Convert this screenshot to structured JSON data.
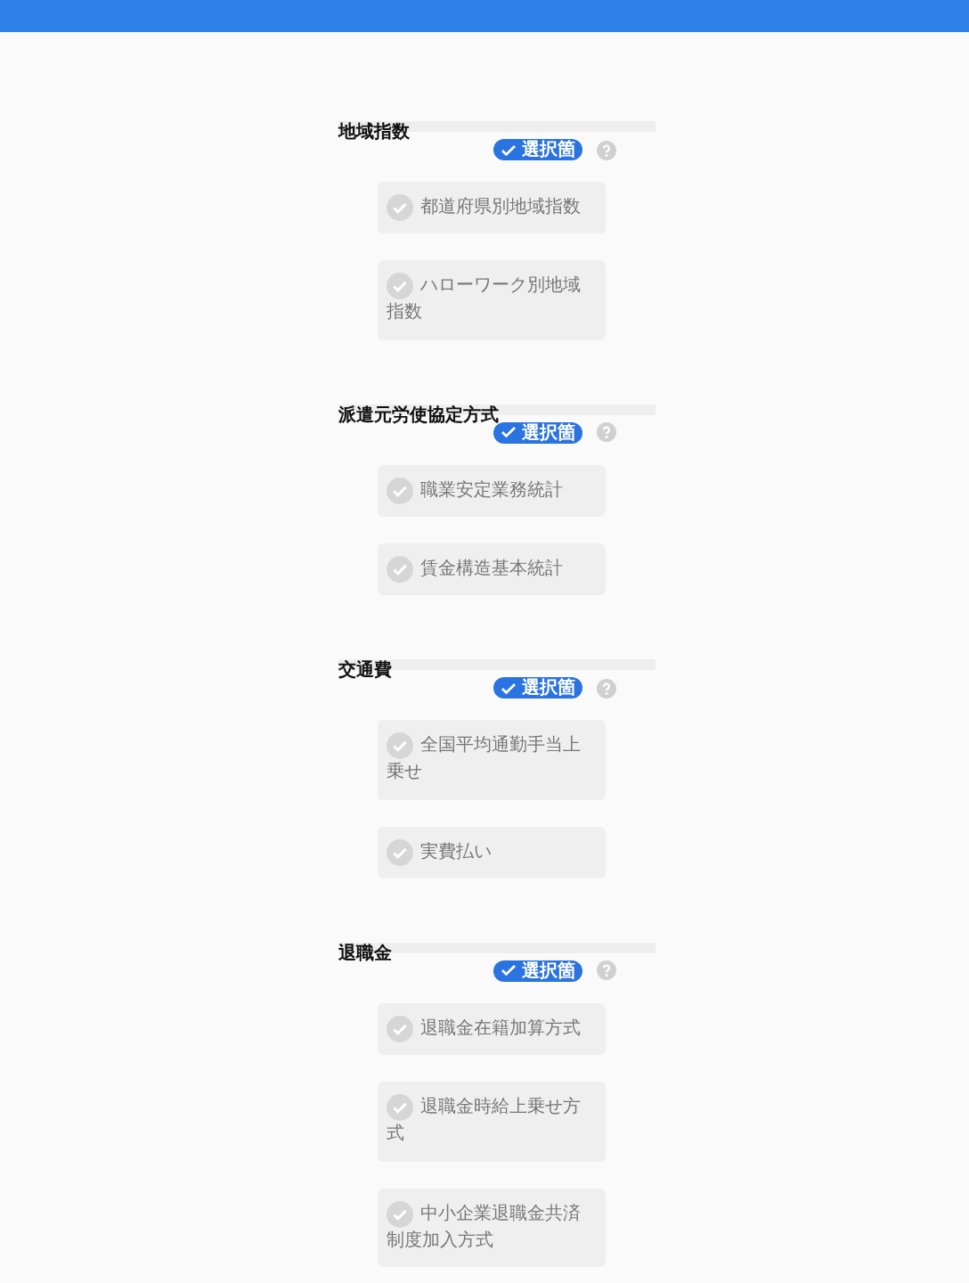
{
  "sections": [
    {
      "title": "地域指数",
      "badge": {
        "label": "選択箇",
        "checked": true
      },
      "options": [
        {
          "label": "都道府県別地域指数",
          "checked": false
        },
        {
          "label": "ハローワーク別地域指数",
          "checked": false
        }
      ]
    },
    {
      "title": "派遣元労使協定方式",
      "badge": {
        "label": "選択箇",
        "checked": true
      },
      "options": [
        {
          "label": "職業安定業務統計",
          "checked": false
        },
        {
          "label": "賃金構造基本統計",
          "checked": false
        }
      ]
    },
    {
      "title": "交通費",
      "badge": {
        "label": "選択箇",
        "checked": true
      },
      "options": [
        {
          "label": "全国平均通勤手当上乗せ",
          "checked": false
        },
        {
          "label": "実費払い",
          "checked": false
        }
      ]
    },
    {
      "title": "退職金",
      "badge": {
        "label": "選択箇",
        "checked": true
      },
      "options": [
        {
          "label": "退職金在籍加算方式",
          "checked": false
        },
        {
          "label": "退職金時給上乗せ方式",
          "checked": false
        },
        {
          "label": "中小企業退職金共済制度加入方式",
          "checked": false
        }
      ]
    }
  ]
}
